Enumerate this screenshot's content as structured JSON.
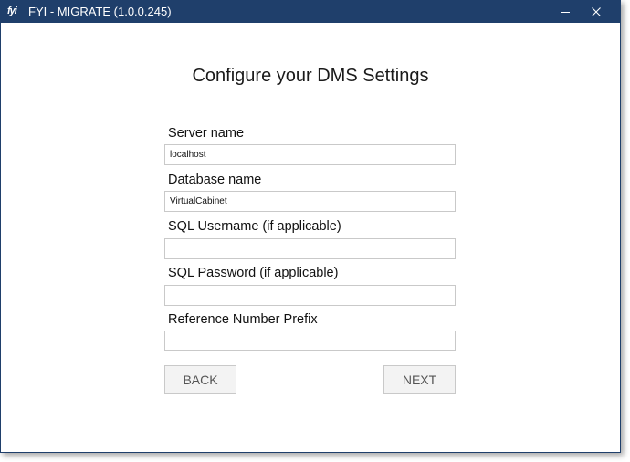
{
  "window": {
    "icon_text": "fyi",
    "title": "FYI - MIGRATE (1.0.0.245)",
    "titlebar_color": "#1f3f6b"
  },
  "page": {
    "heading": "Configure your DMS Settings"
  },
  "form": {
    "server_name": {
      "label": "Server name",
      "value": "localhost"
    },
    "database_name": {
      "label": "Database name",
      "value": "VirtualCabinet"
    },
    "sql_username": {
      "label": "SQL Username (if applicable)",
      "value": ""
    },
    "sql_password": {
      "label": "SQL Password (if applicable)",
      "value": ""
    },
    "reference_prefix": {
      "label": "Reference Number Prefix",
      "value": ""
    }
  },
  "buttons": {
    "back": "BACK",
    "next": "NEXT"
  },
  "icons": {
    "minimize": "minimize-icon",
    "close": "close-icon"
  }
}
